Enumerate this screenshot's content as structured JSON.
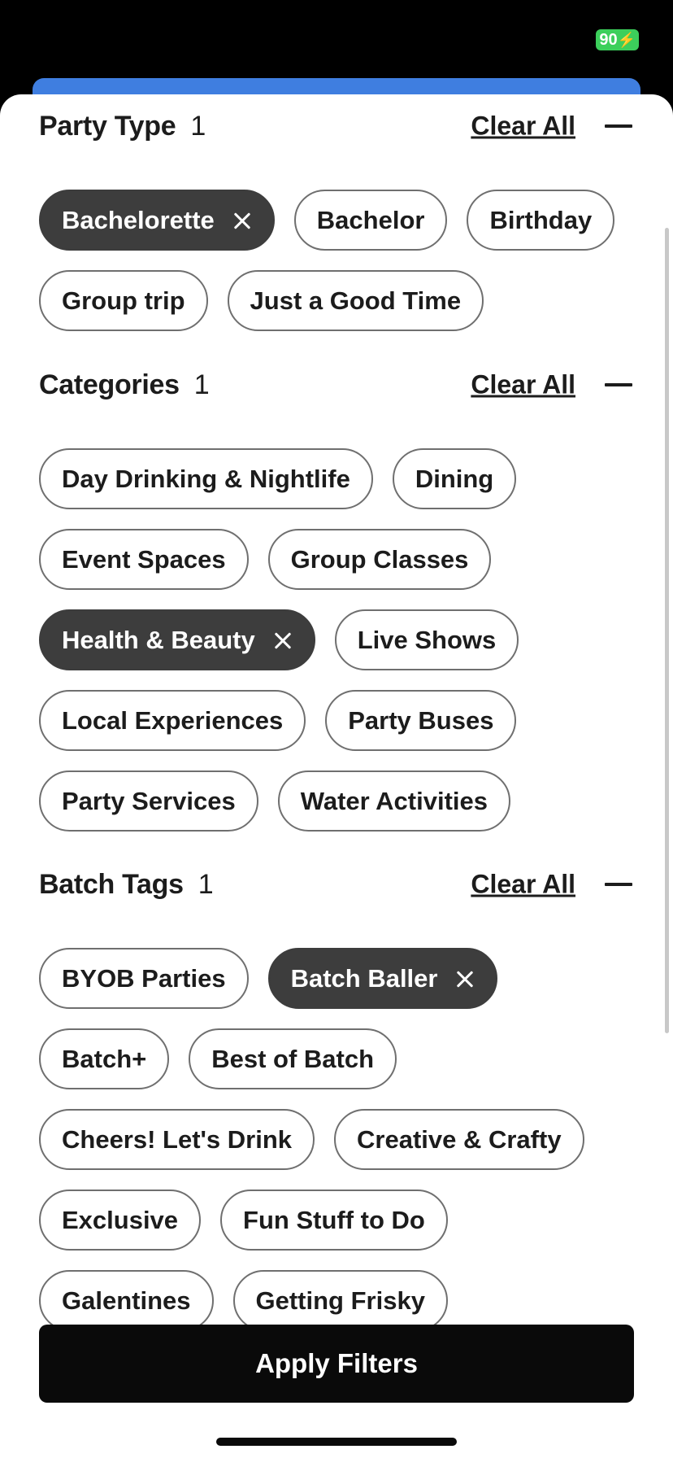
{
  "status_bar": {
    "battery": "90"
  },
  "sections": [
    {
      "title": "Party Type",
      "count": "1",
      "clear_label": "Clear All",
      "chips": [
        {
          "label": "Bachelorette",
          "selected": true
        },
        {
          "label": "Bachelor",
          "selected": false
        },
        {
          "label": "Birthday",
          "selected": false
        },
        {
          "label": "Group trip",
          "selected": false
        },
        {
          "label": "Just a Good Time",
          "selected": false
        }
      ]
    },
    {
      "title": "Categories",
      "count": "1",
      "clear_label": "Clear All",
      "chips": [
        {
          "label": "Day Drinking & Nightlife",
          "selected": false
        },
        {
          "label": "Dining",
          "selected": false
        },
        {
          "label": "Event Spaces",
          "selected": false
        },
        {
          "label": "Group Classes",
          "selected": false
        },
        {
          "label": "Health & Beauty",
          "selected": true
        },
        {
          "label": "Live Shows",
          "selected": false
        },
        {
          "label": "Local Experiences",
          "selected": false
        },
        {
          "label": "Party Buses",
          "selected": false
        },
        {
          "label": "Party Services",
          "selected": false
        },
        {
          "label": "Water Activities",
          "selected": false
        }
      ]
    },
    {
      "title": "Batch Tags",
      "count": "1",
      "clear_label": "Clear All",
      "chips": [
        {
          "label": "BYOB Parties",
          "selected": false
        },
        {
          "label": "Batch Baller",
          "selected": true
        },
        {
          "label": "Batch+",
          "selected": false
        },
        {
          "label": "Best of Batch",
          "selected": false
        },
        {
          "label": "Cheers! Let's Drink",
          "selected": false
        },
        {
          "label": "Creative & Crafty",
          "selected": false
        },
        {
          "label": "Exclusive",
          "selected": false
        },
        {
          "label": "Fun Stuff to Do",
          "selected": false
        },
        {
          "label": "Galentines",
          "selected": false
        },
        {
          "label": "Getting Frisky",
          "selected": false
        }
      ]
    }
  ],
  "apply_button": {
    "label": "Apply Filters"
  },
  "colors": {
    "accent_blue": "#3f7ee0",
    "chip_selected": "#3d3d3d",
    "battery": "#3ccf5b"
  }
}
